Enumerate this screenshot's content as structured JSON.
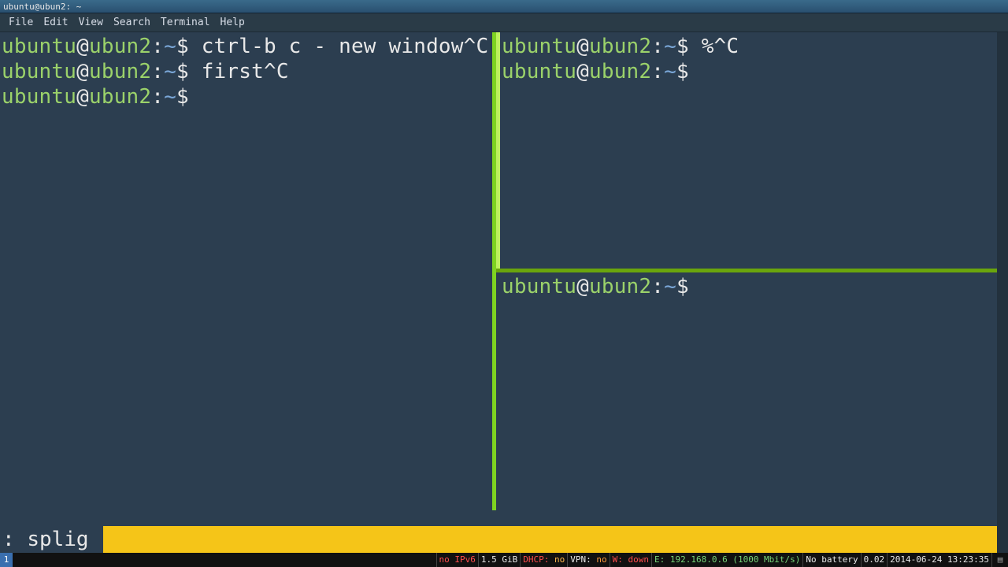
{
  "window": {
    "title": "ubuntu@ubun2: ~"
  },
  "menu": {
    "file": "File",
    "edit": "Edit",
    "view": "View",
    "search": "Search",
    "terminal": "Terminal",
    "help": "Help"
  },
  "prompt": {
    "user": "ubuntu",
    "at": "@",
    "host": "ubun2",
    "sep": ":",
    "path": "~",
    "dollar": "$"
  },
  "panes": {
    "left": {
      "lines": [
        {
          "cmd": "ctrl-b c - new window^C"
        },
        {
          "cmd": "first^C"
        },
        {
          "cmd": ""
        }
      ]
    },
    "top_right": {
      "lines": [
        {
          "cmd": "%^C"
        },
        {
          "cmd": ""
        }
      ]
    },
    "bottom_right": {
      "lines": [
        {
          "cmd": ""
        }
      ]
    }
  },
  "cmdbar": {
    "prefix": ":",
    "text": "splig"
  },
  "statusbar": {
    "workspace": "1",
    "ipv6": "no IPv6",
    "mem": "1.5 GiB",
    "dhcp_label": "DHCP:",
    "dhcp_value": "no",
    "vpn_label": "VPN:",
    "vpn_value": "no",
    "wlan": "W: down",
    "eth": "E: 192.168.0.6 (1000 Mbit/s)",
    "battery": "No battery",
    "load": "0.02",
    "date": "2014-06-24 13:23:35"
  }
}
